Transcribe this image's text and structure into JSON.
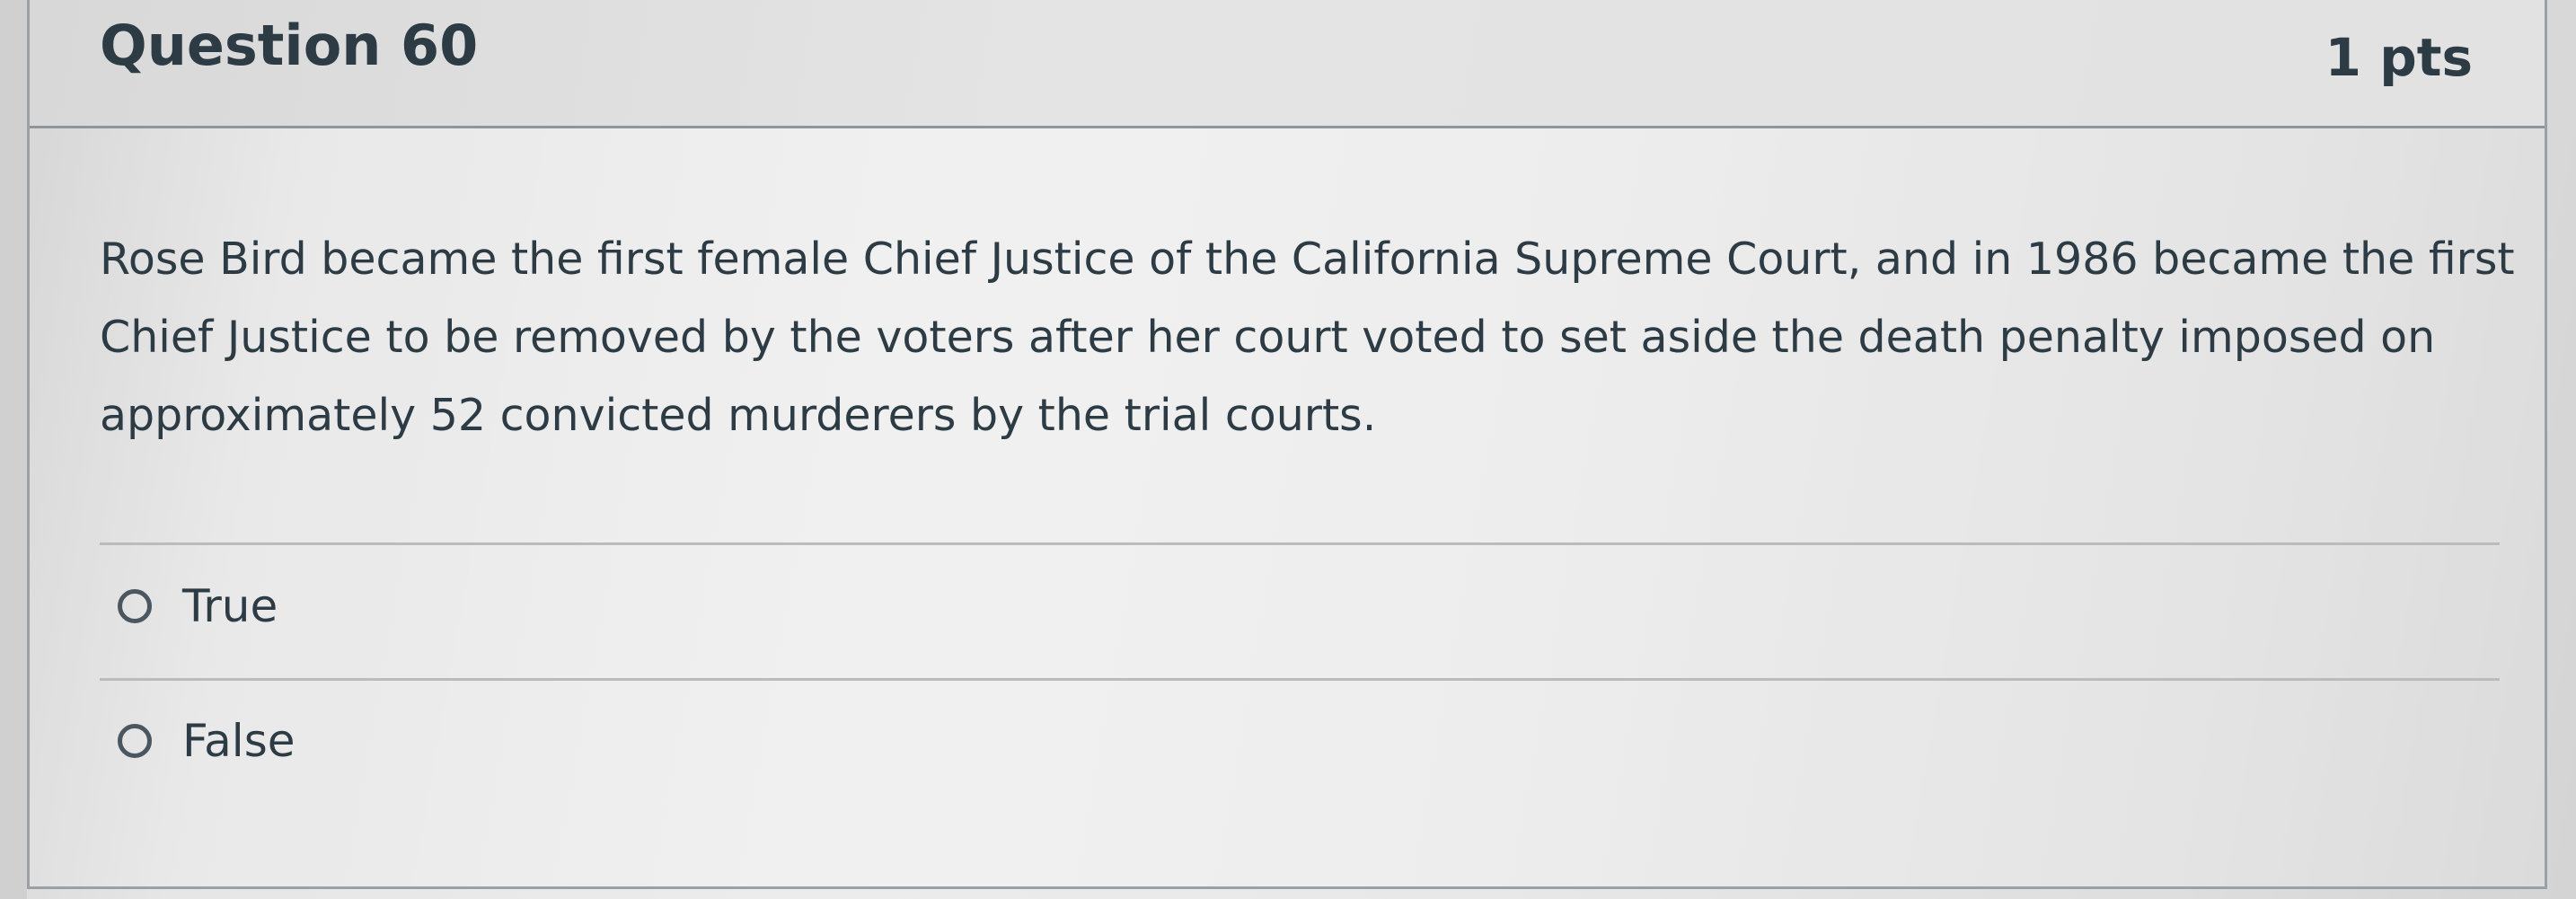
{
  "question": {
    "title": "Question 60",
    "points": "1 pts",
    "text": "Rose Bird became the first female Chief Justice of the California Supreme Court, and in 1986 became the first Chief Justice to be removed by the voters after her court voted to set aside the death penalty imposed on approximately 52 convicted murderers by the trial courts."
  },
  "answers": [
    {
      "label": "True",
      "selected": false
    },
    {
      "label": "False",
      "selected": false
    }
  ],
  "colors": {
    "text": "#2d3b45",
    "border": "#9aa0a4",
    "divider": "#b8bcbf"
  }
}
